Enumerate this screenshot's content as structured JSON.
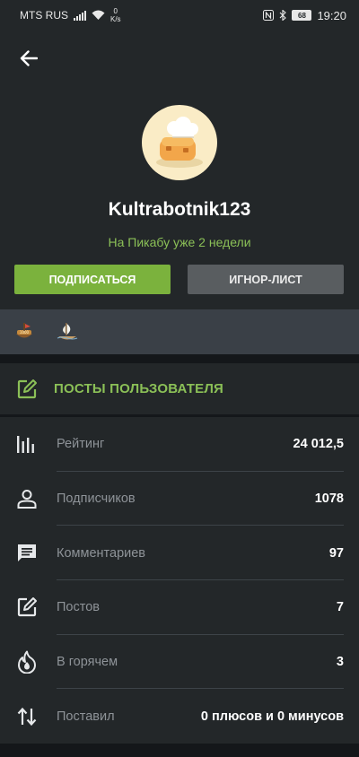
{
  "status_bar": {
    "carrier": "MTS RUS",
    "speed_value": "0",
    "speed_unit": "K/s",
    "battery": "68",
    "time": "19:20",
    "icons": [
      "signal-icon",
      "wifi-icon",
      "nfc-icon",
      "bluetooth-icon",
      "battery-icon"
    ]
  },
  "profile": {
    "username": "Kultrabotnik123",
    "since": "На Пикабу уже 2 недели",
    "subscribe_label": "ПОДПИСАТЬСЯ",
    "ignore_label": "ИГНОР-ЛИСТ"
  },
  "badges": [
    "award-1000-icon",
    "award-ship-icon"
  ],
  "posts_link": {
    "label": "ПОСТЫ ПОЛЬЗОВАТЕЛЯ"
  },
  "stats": [
    {
      "icon": "rating-bars-icon",
      "label": "Рейтинг",
      "value": "24 012,5"
    },
    {
      "icon": "person-icon",
      "label": "Подписчиков",
      "value": "1078"
    },
    {
      "icon": "comment-icon",
      "label": "Комментариев",
      "value": "97"
    },
    {
      "icon": "edit-icon",
      "label": "Постов",
      "value": "7"
    },
    {
      "icon": "fire-icon",
      "label": "В горячем",
      "value": "3"
    },
    {
      "icon": "up-down-arrows-icon",
      "label": "Поставил",
      "value": "0 плюсов и 0 минусов"
    }
  ],
  "colors": {
    "background": "#14171a",
    "panel": "#232729",
    "accent_green": "#8bc057",
    "button_green": "#7bb23d",
    "button_gray": "#595d60",
    "badge_strip": "#3a4047"
  }
}
